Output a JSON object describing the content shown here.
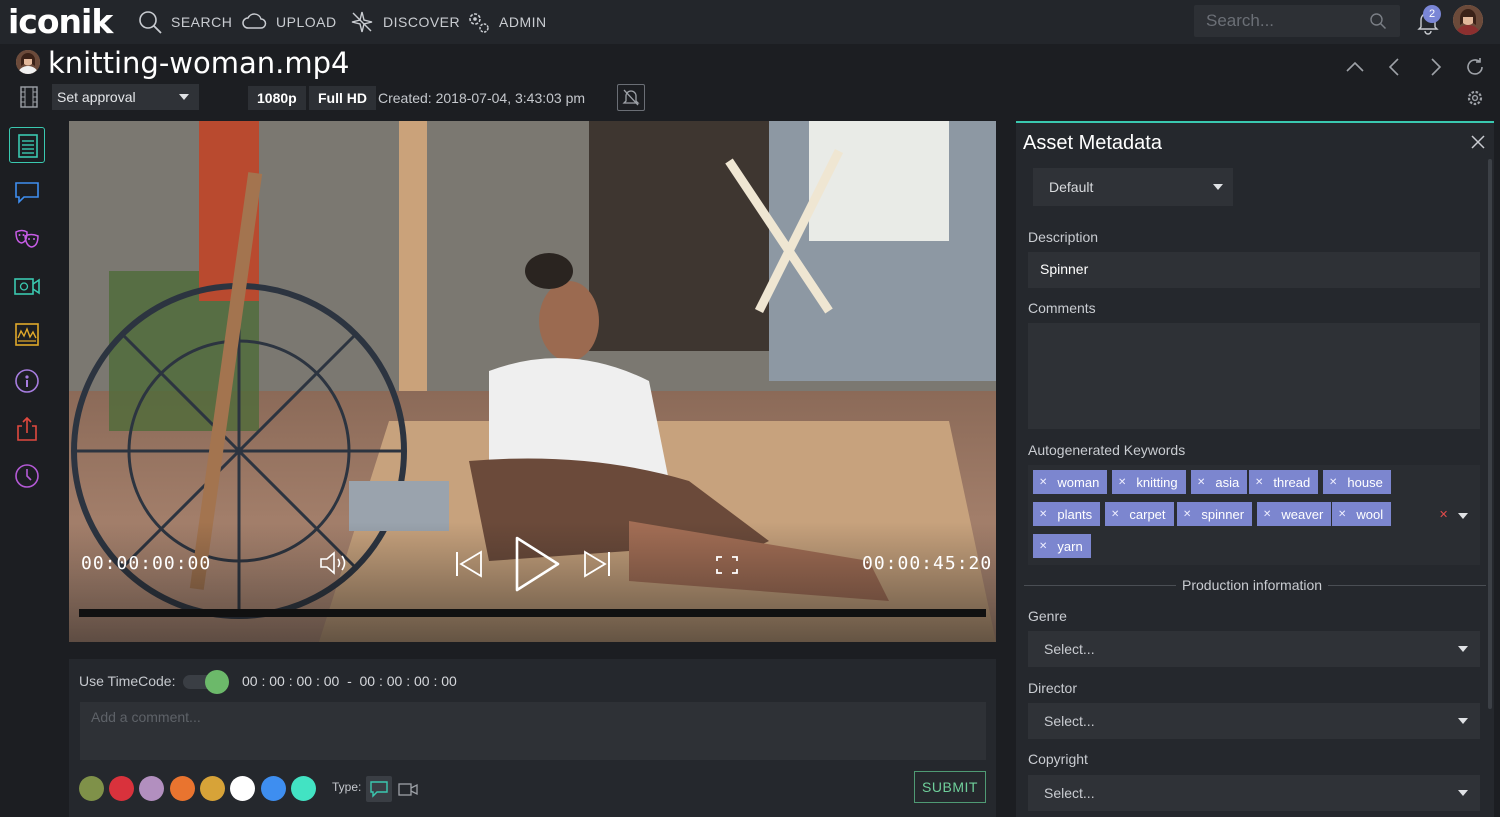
{
  "app": {
    "logo": "iconik",
    "nav": [
      {
        "id": "search",
        "label": "SEARCH",
        "icon": "search-icon"
      },
      {
        "id": "upload",
        "label": "UPLOAD",
        "icon": "cloud-upload-icon"
      },
      {
        "id": "discover",
        "label": "DISCOVER",
        "icon": "discover-icon"
      },
      {
        "id": "admin",
        "label": "ADMIN",
        "icon": "gears-icon"
      }
    ],
    "search_placeholder": "Search...",
    "notifications_count": "2"
  },
  "asset": {
    "title": "knitting-woman.mp4",
    "approval": "Set approval",
    "resolution": "1080p",
    "quality": "Full HD",
    "created": "Created: 2018-07-04, 3:43:03 pm"
  },
  "player": {
    "current_tc": "00:00:00:00",
    "duration_tc": "00:00:45:20",
    "progress": 0
  },
  "comment": {
    "tc_label": "Use TimeCode:",
    "tc_range": "00 : 00 : 00 : 00  -  00 : 00 : 00 : 00",
    "placeholder": "Add a comment...",
    "type_label": "Type:",
    "submit": "SUBMIT",
    "colors": [
      "#7f9149",
      "#d9323c",
      "#b28fbf",
      "#e9742f",
      "#d7a338",
      "#ffffff",
      "#3e8ef0",
      "#42e3c3"
    ]
  },
  "metadata": {
    "title": "Asset Metadata",
    "view": "Default",
    "description_label": "Description",
    "description_value": "Spinner",
    "comments_label": "Comments",
    "keywords_label": "Autogenerated Keywords",
    "keywords": [
      "woman",
      "knitting",
      "asia",
      "thread",
      "house",
      "plants",
      "carpet",
      "spinner",
      "weaver",
      "wool",
      "yarn"
    ],
    "section": "Production information",
    "genre_label": "Genre",
    "director_label": "Director",
    "copyright_label": "Copyright",
    "select_placeholder": "Select..."
  }
}
